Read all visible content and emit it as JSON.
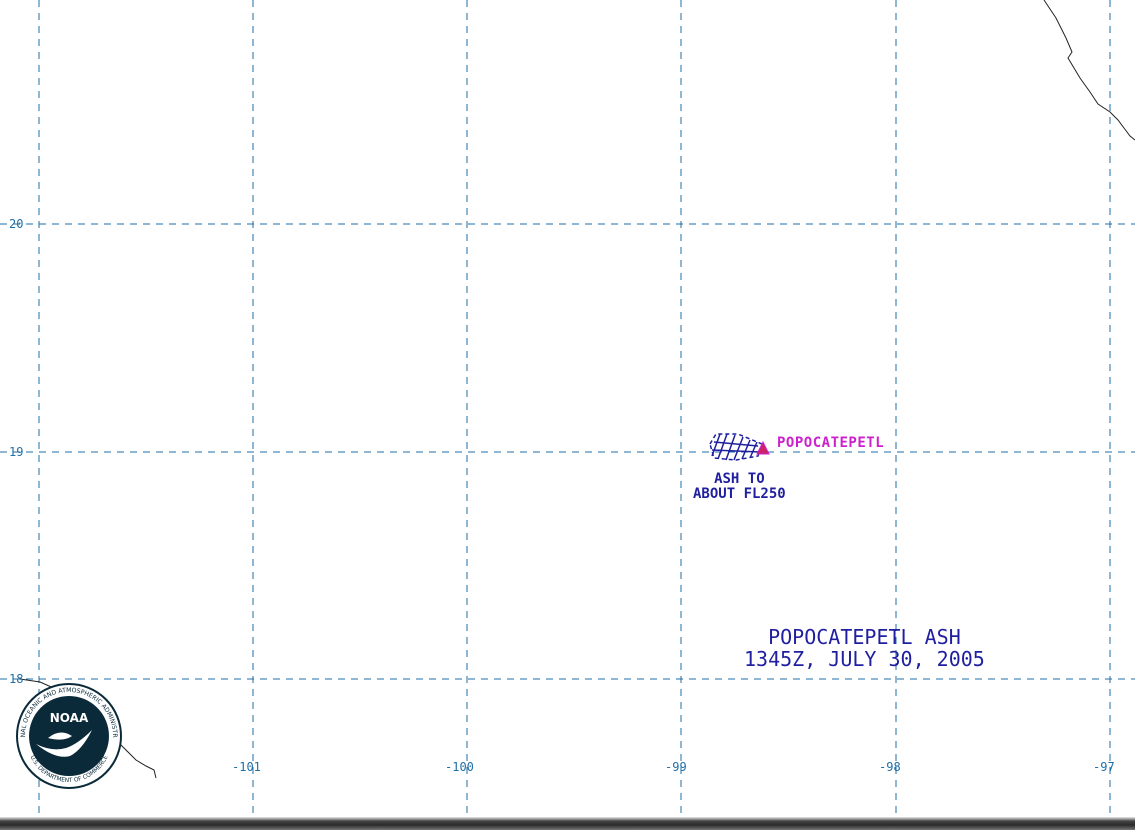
{
  "map": {
    "latitude_labels": [
      "20",
      "19",
      "18"
    ],
    "longitude_labels": [
      "-101",
      "-100",
      "-99",
      "-98",
      "-97"
    ],
    "grid": "dashed",
    "grid_color": "#1f6fa8"
  },
  "volcano": {
    "name": "POPOCATEPETL",
    "marker_icon": "volcano-triangle-icon",
    "color": "#cc22cc"
  },
  "ash_annotation": {
    "line1": "ASH TO",
    "line2": "ABOUT FL250",
    "color": "#1f1fa0"
  },
  "title": {
    "line1": "POPOCATEPETL ASH",
    "line2": "1345Z, JULY 30, 2005",
    "color": "#1f1fa0"
  },
  "logo": {
    "center_text": "NOAA",
    "ring_text": "NATIONAL OCEANIC AND ATMOSPHERIC ADMINISTRATION",
    "bottom_text": "U.S. DEPARTMENT OF COMMERCE"
  }
}
